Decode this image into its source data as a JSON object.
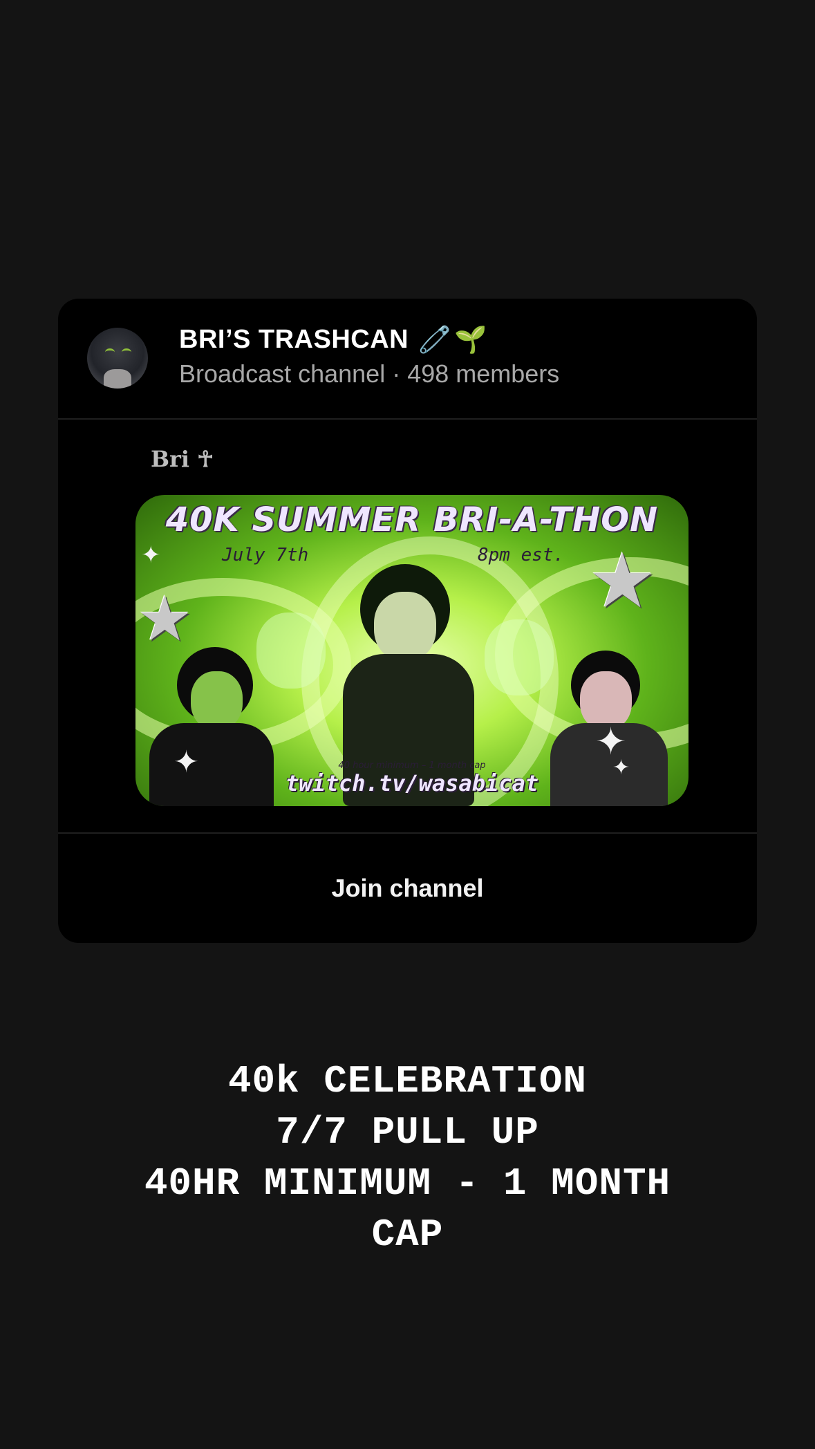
{
  "channel": {
    "name": "BRI’S TRASHCAN",
    "name_emojis": [
      "🧷",
      "🌱"
    ],
    "subtitle": "Broadcast channel · 498 members"
  },
  "message": {
    "author": "Bri ☥"
  },
  "poster": {
    "title": "40K SUMMER BRI-A-THON",
    "date": "July 7th",
    "time": "8pm est.",
    "note": "40 hour minimum – 1 month cap",
    "url": "twitch.tv/wasabicat",
    "colors": {
      "primary_green": "#b6f04a",
      "dark_green": "#2f6a0b",
      "text_lavender": "#efe6ff"
    }
  },
  "join": {
    "label": "Join channel"
  },
  "caption": {
    "lines": [
      "40k CELEBRATION",
      "7/7 PULL UP",
      "40HR MINIMUM - 1 MONTH",
      "CAP"
    ]
  },
  "theme": {
    "background": "#141414",
    "card_background": "#000000",
    "secondary_text": "#a8a8a8"
  }
}
